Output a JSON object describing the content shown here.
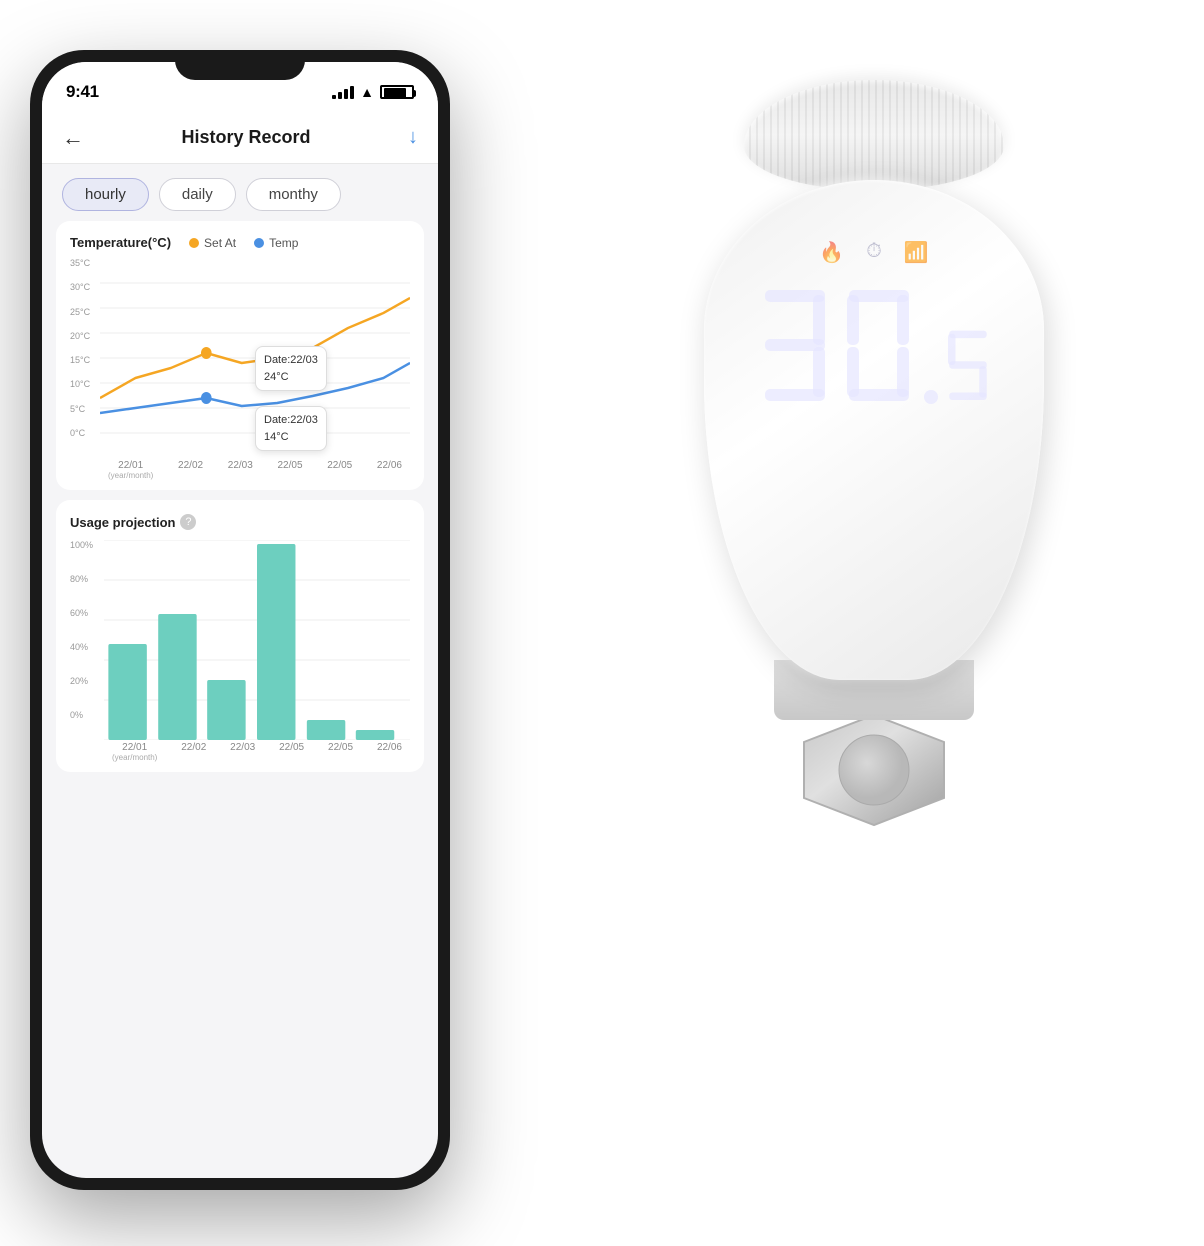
{
  "scene": {
    "background": "#ffffff"
  },
  "phone": {
    "status": {
      "time": "9:41",
      "signal": "full",
      "wifi": "on",
      "battery": "full"
    },
    "header": {
      "back_label": "←",
      "title": "History Record",
      "download_icon": "↓"
    },
    "tabs": [
      {
        "label": "hourly",
        "active": true
      },
      {
        "label": "daily",
        "active": false
      },
      {
        "label": "monthy",
        "active": false
      }
    ],
    "temp_chart": {
      "title": "Temperature(°C)",
      "legend": [
        {
          "label": "Set At",
          "color": "#f5a623"
        },
        {
          "label": "Temp",
          "color": "#4a90e2"
        }
      ],
      "y_labels": [
        "35°C",
        "30°C",
        "25°C",
        "20°C",
        "15°C",
        "10°C",
        "5°C",
        "0°C"
      ],
      "x_labels": [
        {
          "main": "22/01",
          "sub": "(year/month)"
        },
        {
          "main": "22/02",
          "sub": ""
        },
        {
          "main": "22/03",
          "sub": ""
        },
        {
          "main": "22/05",
          "sub": ""
        },
        {
          "main": "22/05",
          "sub": ""
        },
        {
          "main": "22/06",
          "sub": ""
        }
      ],
      "tooltip_orange": {
        "line1": "Date:22/03",
        "line2": "24°C"
      },
      "tooltip_blue": {
        "line1": "Date:22/03",
        "line2": "14°C"
      }
    },
    "usage_chart": {
      "title": "Usage projection",
      "y_labels": [
        "100%",
        "80%",
        "60%",
        "40%",
        "20%",
        "0%"
      ],
      "x_labels": [
        {
          "main": "22/01",
          "sub": "(year/month)"
        },
        {
          "main": "22/02",
          "sub": ""
        },
        {
          "main": "22/03",
          "sub": ""
        },
        {
          "main": "22/05",
          "sub": ""
        },
        {
          "main": "22/05",
          "sub": ""
        },
        {
          "main": "22/06",
          "sub": ""
        }
      ],
      "bars": [
        {
          "label": "22/01",
          "height_pct": 48
        },
        {
          "label": "22/02",
          "height_pct": 63
        },
        {
          "label": "22/03",
          "height_pct": 30
        },
        {
          "label": "22/05",
          "height_pct": 98
        },
        {
          "label": "22/05",
          "height_pct": 10
        },
        {
          "label": "22/06",
          "height_pct": 5
        }
      ],
      "bar_color": "#6dcfbf"
    }
  },
  "device": {
    "display_value": "30",
    "display_sub": "5",
    "icon_fire": "🔥",
    "icon_clock": "⏱",
    "icon_wifi": "📶"
  }
}
